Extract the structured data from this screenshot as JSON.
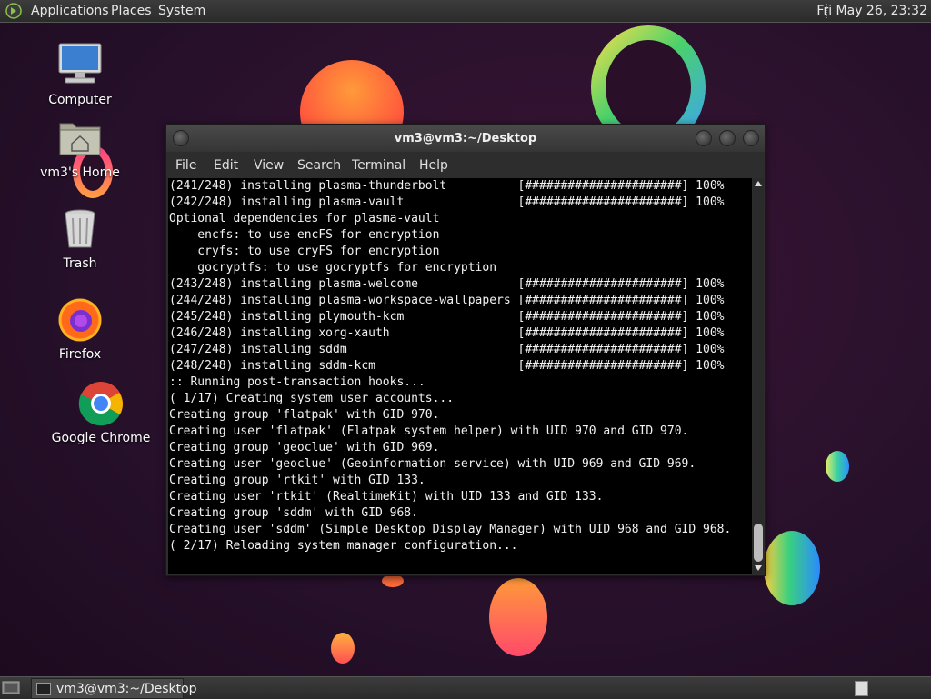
{
  "top_panel": {
    "menus": [
      "Applications",
      "Places",
      "System"
    ],
    "clock": "Fri May 26, 23:32"
  },
  "desktop_icons": [
    {
      "label": "Computer",
      "icon": "computer-icon"
    },
    {
      "label": "vm3's Home",
      "icon": "home-folder-icon"
    },
    {
      "label": "Trash",
      "icon": "trash-icon"
    },
    {
      "label": "Firefox",
      "icon": "firefox-icon"
    },
    {
      "label": "Google Chrome",
      "icon": "chrome-icon"
    }
  ],
  "terminal": {
    "title": "vm3@vm3:~/Desktop",
    "menu": [
      "File",
      "Edit",
      "View",
      "Search",
      "Terminal",
      "Help"
    ],
    "lines": [
      "(241/248) installing plasma-thunderbolt          [######################] 100%",
      "(242/248) installing plasma-vault                [######################] 100%",
      "Optional dependencies for plasma-vault",
      "    encfs: to use encFS for encryption",
      "    cryfs: to use cryFS for encryption",
      "    gocryptfs: to use gocryptfs for encryption",
      "(243/248) installing plasma-welcome              [######################] 100%",
      "(244/248) installing plasma-workspace-wallpapers [######################] 100%",
      "(245/248) installing plymouth-kcm                [######################] 100%",
      "(246/248) installing xorg-xauth                  [######################] 100%",
      "(247/248) installing sddm                        [######################] 100%",
      "(248/248) installing sddm-kcm                    [######################] 100%",
      ":: Running post-transaction hooks...",
      "( 1/17) Creating system user accounts...",
      "Creating group 'flatpak' with GID 970.",
      "Creating user 'flatpak' (Flatpak system helper) with UID 970 and GID 970.",
      "Creating group 'geoclue' with GID 969.",
      "Creating user 'geoclue' (Geoinformation service) with UID 969 and GID 969.",
      "Creating group 'rtkit' with GID 133.",
      "Creating user 'rtkit' (RealtimeKit) with UID 133 and GID 133.",
      "Creating group 'sddm' with GID 968.",
      "Creating user 'sddm' (Simple Desktop Display Manager) with UID 968 and GID 968.",
      "( 2/17) Reloading system manager configuration..."
    ]
  },
  "taskbar": {
    "task_label": "vm3@vm3:~/Desktop"
  }
}
